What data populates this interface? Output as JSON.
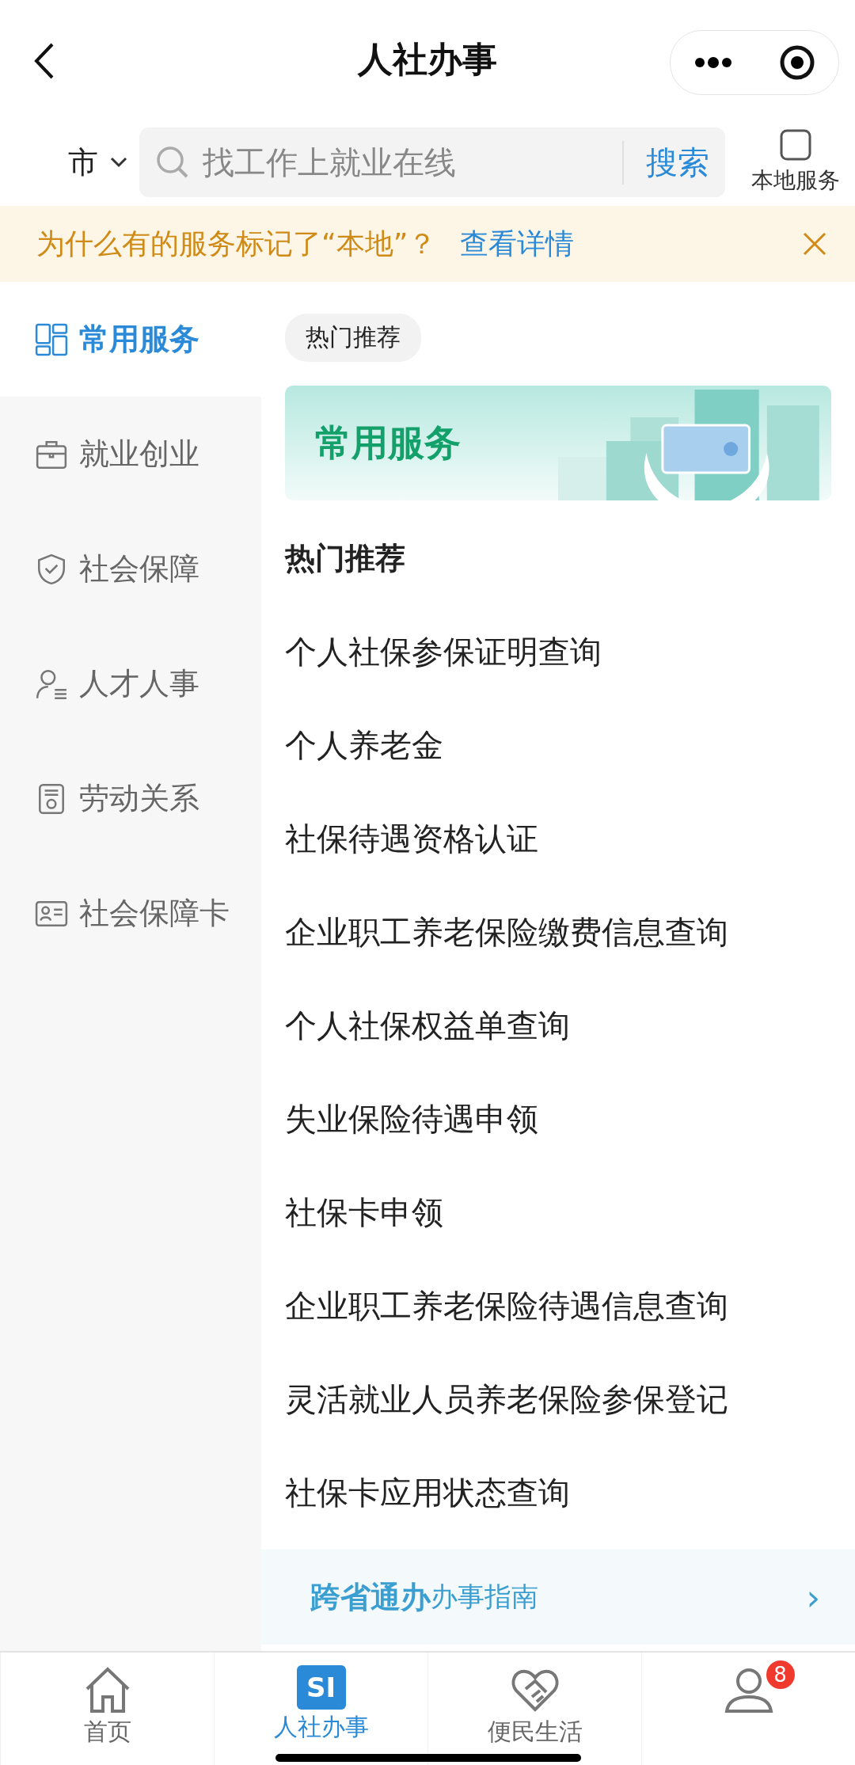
{
  "header": {
    "title": "人社办事"
  },
  "search_row": {
    "city": "市",
    "placeholder": "找工作上就业在线",
    "search_button": "搜索",
    "local_service": "本地服务"
  },
  "notice": {
    "text": "为什么有的服务标记了“本地”？",
    "link": "查看详情"
  },
  "sidebar": {
    "items": [
      {
        "label": "常用服务",
        "selected": true
      },
      {
        "label": "就业创业",
        "selected": false
      },
      {
        "label": "社会保障",
        "selected": false
      },
      {
        "label": "人才人事",
        "selected": false
      },
      {
        "label": "劳动关系",
        "selected": false
      },
      {
        "label": "社会保障卡",
        "selected": false
      }
    ]
  },
  "content": {
    "chips": [
      {
        "label": "热门推荐",
        "selected": true
      }
    ],
    "banner_title": "常用服务",
    "section_title": "热门推荐",
    "services": [
      "个人社保参保证明查询",
      "个人养老金",
      "社保待遇资格认证",
      "企业职工养老保险缴费信息查询",
      "个人社保权益单查询",
      "失业保险待遇申领",
      "社保卡申领",
      "企业职工养老保险待遇信息查询",
      "灵活就业人员养老保险参保登记",
      "社保卡应用状态查询"
    ],
    "guide": {
      "title": "跨省通办",
      "subtitle": "办事指南",
      "arrow": "›"
    }
  },
  "tab_bar": {
    "items": [
      {
        "label": "首页",
        "selected": false
      },
      {
        "label": "人社办事",
        "badge_text": "SI",
        "selected": true
      },
      {
        "label": "便民生活",
        "selected": false
      },
      {
        "badge": "8",
        "selected": false
      }
    ]
  }
}
